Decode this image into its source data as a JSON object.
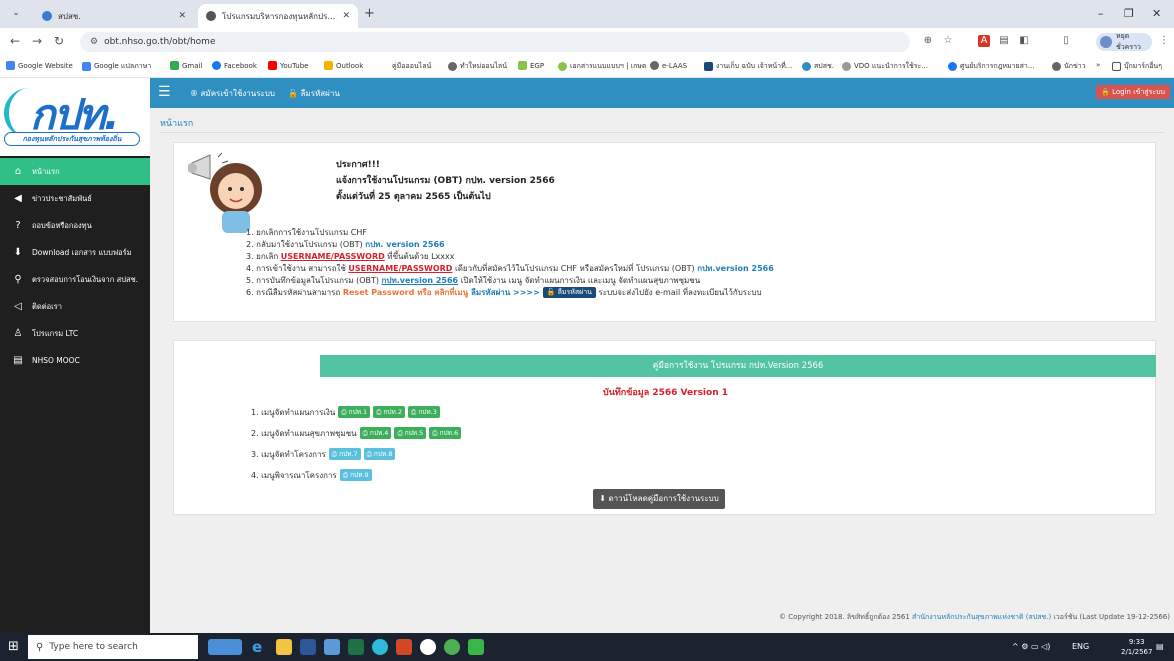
{
  "browser": {
    "tabs": [
      {
        "label": "สปสช.",
        "active": false
      },
      {
        "label": "โปรแกรมบริหารกองทุนหลักประกันฯ",
        "active": true
      }
    ],
    "address": "obt.nhso.go.th/obt/home",
    "profile_label": "หยุดชั่วคราว",
    "bookmarks": [
      "Google Website",
      "Google แปลภาษา",
      "Gmail",
      "Facebook",
      "YouTube",
      "Outlook",
      "คู่มือออนไลน์",
      "ทำใหม่ออนไลน์",
      "EGP",
      "เอกสารแนบแบบฯ | เกษต...",
      "e-LAAS",
      "งานเก็บ ฉบับ เจ้าหน้าที่...",
      "สปสช.",
      "VDO แนะนำการใช้ระ...",
      "ศูนย์บริการกฎหมายสา...",
      "นักข่าว",
      "บุ๊กมาร์กอื่นๆ"
    ],
    "icons": {
      "back": "arrow-left-icon",
      "forward": "arrow-right-icon",
      "reload": "reload-icon"
    }
  },
  "site": {
    "logo_text": "กปท.",
    "logo_sub": "กองทุนหลักประกันสุขภาพท้องถิ่น",
    "menu": [
      {
        "label": "หน้าแรก",
        "icon": "home-icon",
        "active": true
      },
      {
        "label": "ข่าวประชาสัมพันธ์",
        "icon": "megaphone-icon",
        "active": false
      },
      {
        "label": "ถอบข้อหรือกองทุน",
        "icon": "question-icon",
        "active": false
      },
      {
        "label": "Download เอกสาร แบบฟอร์ม",
        "icon": "download-icon",
        "active": false
      },
      {
        "label": "ตรวจสอบการโอนเงินจาก สปสช.",
        "icon": "search-icon",
        "active": false
      },
      {
        "label": "ติดต่อเรา",
        "icon": "share-icon",
        "active": false
      },
      {
        "label": "โปรแกรม LTC",
        "icon": "user-icon",
        "active": false
      },
      {
        "label": "NHSO MOOC",
        "icon": "book-icon",
        "active": false
      }
    ],
    "topnav": {
      "register": "สมัครเข้าใช้งานระบบ",
      "forgot": "ลืมรหัสผ่าน",
      "login": "Login เข้าสู่ระบบ"
    },
    "breadcrumb": "หน้าแรก"
  },
  "announcement": {
    "title": "ประกาศ!!!",
    "line1": "แจ้งการใช้งานโปรแกรม (OBT) กปท. version 2566",
    "line2": "ตั้งแต่วันที่ 25 ตุลาคม 2565 เป็นต้นไป",
    "items": {
      "i1": "1. ยกเลิกการใช้งานโปรแกรม CHF",
      "i2_pre": "2. กลับมาใช้งานโปรแกรม (OBT) ",
      "i2_hl": "กปท. version 2566",
      "i3_pre": "3. ยกเลิก ",
      "i3_hl": "USERNAME/PASSWORD",
      "i3_post": " ที่ขึ้นต้นด้วย Lxxxx",
      "i4_pre": "4. การเข้าใช้งาน สามารถใช้ ",
      "i4_hl": "USERNAME/PASSWORD",
      "i4_mid": " เดียวกับที่สมัครไว้ในโปรแกรม CHF หรือสมัครใหม่ที่ โปรแกรม (OBT) ",
      "i4_hl2": "กปท.version 2566",
      "i5_pre": "5. การบันทึกข้อมูลในโปรแกรม (OBT) ",
      "i5_hl": "กปท.version 2566",
      "i5_post": " เปิดให้ใช้งาน เมนู จัดทำแผนการเงิน และเมนู จัดทำแผนสุขภาพชุมชน",
      "i6_pre": "6. กรณีลืมรหัสผ่านสามารถ ",
      "i6_hl": "Reset Password หรือ คลิกที่เมนู",
      "i6_hl2": " ลืมรหัสผ่าน >>>> ",
      "i6_btn": "ลืมรหัสผ่าน",
      "i6_post": " ระบบจะส่งไปยัง e-mail ที่ลงทะเบียนไว้กับระบบ"
    }
  },
  "manual": {
    "bar": "คู่มือการใช้งาน โปรแกรม กปท.Version 2566",
    "title": "บันทึกข้อมูล 2566 Version 1",
    "rows": [
      {
        "label": "1. เมนูจัดทำแผนการเงิน",
        "buttons": [
          "กปท.1",
          "กปท.2",
          "กปท.3"
        ]
      },
      {
        "label": "2. เมนูจัดทำแผนสุขภาพชุมชน",
        "buttons": [
          "กปท.4",
          "กปท.5",
          "กปท.6"
        ]
      },
      {
        "label": "3. เมนูจัดทำโครงการ",
        "buttons": [
          "กปท.7",
          "กปท.8"
        ]
      },
      {
        "label": "4. เมนูพิจารณาโครงการ",
        "buttons": [
          "กปท.9"
        ]
      }
    ],
    "download": "ดาวน์โหลดคู่มือการใช้งานระบบ"
  },
  "footer": {
    "copyright_pre": "© Copyright 2018. ลิขสิทธิ์ถูกต้อง 2561 ",
    "copyright_hl": "สำนักงานหลักประกันสุขภาพแห่งชาติ (สปสช.)",
    "copyright_post": " เวอร์ชัน (Last Update 19-12-2566)"
  },
  "taskbar": {
    "search_placeholder": "Type here to search",
    "lang": "ENG",
    "time": "9:33",
    "date": "2/1/2567"
  },
  "colors": {
    "sidebar": "#1f1f1f",
    "active_menu": "#2fbf87",
    "topnav": "#2f8fc0",
    "manual_bar": "#52c4a2",
    "accent_red": "#d2232a"
  }
}
